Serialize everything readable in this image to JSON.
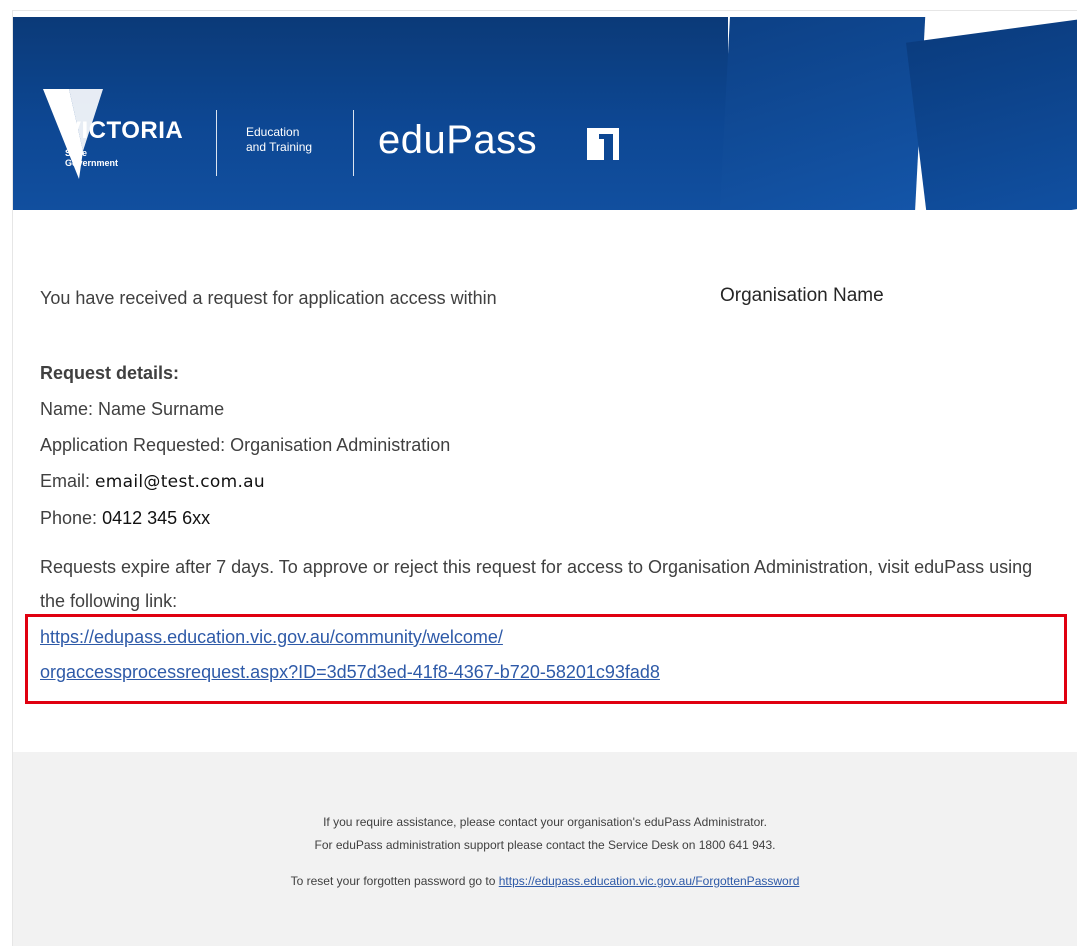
{
  "banner": {
    "logo_word": "VICTORIA",
    "logo_sub_1": "State",
    "logo_sub_2": "Government",
    "dept_line_1": "Education",
    "dept_line_2": "and Training",
    "product": "eduPass",
    "colors": {
      "banner_blue": "#0d4793",
      "accent_white": "#ffffff"
    }
  },
  "body": {
    "intro": "You have received a request for application access within",
    "org_name": "Organisation Name",
    "details_heading": "Request details:",
    "name_label": "Name:",
    "name_value": "Name Surname",
    "app_label": "Application Requested:",
    "app_value": "Organisation Administration",
    "email_label": "Email:",
    "email_value": "email@test.com.au",
    "phone_label": "Phone:",
    "phone_value": "0412 345 6xx",
    "expire_text": "Requests expire after 7 days. To approve or reject this request for access to Organisation Administration, visit eduPass using the following link:",
    "link_line_1": "https://edupass.education.vic.gov.au/community/welcome/",
    "link_line_2": "orgaccessprocessrequest.aspx?ID=3d57d3ed-41f8-4367-b720-58201c93fad8",
    "highlight_color": "#e00010",
    "link_color": "#2e5aa8"
  },
  "footer": {
    "line_1": "If you require assistance, please contact your organisation's eduPass Administrator.",
    "line_2": "For eduPass administration support please contact the Service Desk on 1800 641 943.",
    "line_3_prefix": "To reset your forgotten password go to",
    "line_3_link": "https://edupass.education.vic.gov.au/ForgottenPassword"
  }
}
